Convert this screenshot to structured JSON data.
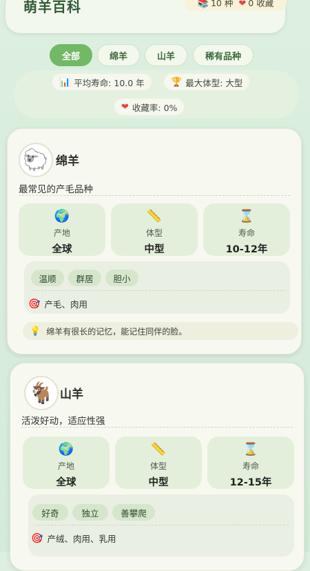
{
  "header": {
    "title": "萌羊百科",
    "count_icon": "books-icon",
    "count_text": "10 种",
    "fav_icon": "heart-icon",
    "fav_text": "0 收藏"
  },
  "filters": [
    {
      "label": "全部",
      "active": true
    },
    {
      "label": "绵羊",
      "active": false
    },
    {
      "label": "山羊",
      "active": false
    },
    {
      "label": "稀有品种",
      "active": false
    }
  ],
  "summary": {
    "avg_life": "平均寿命: 10.0 年",
    "max_size": "最大体型: 大型",
    "fav_rate": "收藏率: 0%"
  },
  "cards": [
    {
      "name": "绵羊",
      "avatar_icon": "sheep-icon",
      "description": "最常见的产毛品种",
      "stats": [
        {
          "icon": "globe-icon",
          "label": "产地",
          "value": "全球"
        },
        {
          "icon": "ruler-icon",
          "label": "体型",
          "value": "中型"
        },
        {
          "icon": "hourglass-icon",
          "label": "寿命",
          "value": "10-12年"
        }
      ],
      "tags": [
        "温顺",
        "群居",
        "胆小"
      ],
      "uses": "产毛、肉用",
      "fact": "绵羊有很长的记忆，能记住同伴的脸。"
    },
    {
      "name": "山羊",
      "avatar_icon": "goat-icon",
      "description": "活泼好动，适应性强",
      "stats": [
        {
          "icon": "globe-icon",
          "label": "产地",
          "value": "全球"
        },
        {
          "icon": "ruler-icon",
          "label": "体型",
          "value": "中型"
        },
        {
          "icon": "hourglass-icon",
          "label": "寿命",
          "value": "12-15年"
        }
      ],
      "tags": [
        "好奇",
        "独立",
        "善攀爬"
      ],
      "uses": "产绒、肉用、乳用"
    }
  ]
}
